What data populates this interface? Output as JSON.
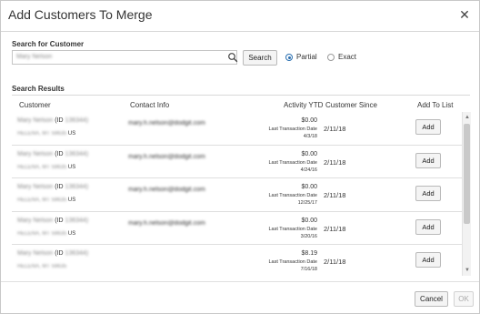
{
  "dialog": {
    "title": "Add Customers To Merge",
    "close_glyph": "✕"
  },
  "search": {
    "label": "Search for Customer",
    "value": "Mary Nelson",
    "button_label": "Search",
    "match_options": [
      {
        "label": "Partial",
        "selected": true
      },
      {
        "label": "Exact",
        "selected": false
      }
    ]
  },
  "results": {
    "label": "Search Results",
    "columns": {
      "customer": "Customer",
      "contact": "Contact Info",
      "activity": "Activity YTD",
      "since": "Customer Since",
      "add": "Add To List"
    },
    "rows": [
      {
        "name": "Mary Nelson",
        "id_prefix": "(ID",
        "id_value": "136344)",
        "address": "HELENA, MT 59635",
        "country": "US",
        "email": "mary.h.nelson@dodgit.com",
        "activity": "$0.00",
        "last_label": "Last Transaction Date",
        "last_date": "4/3/18",
        "since": "2/11/18",
        "add_label": "Add"
      },
      {
        "name": "Mary Nelson",
        "id_prefix": "(ID",
        "id_value": "136344)",
        "address": "HELENA, MT 59635",
        "country": "US",
        "email": "mary.h.nelson@dodgit.com",
        "activity": "$0.00",
        "last_label": "Last Transaction Date",
        "last_date": "4/24/16",
        "since": "2/11/18",
        "add_label": "Add"
      },
      {
        "name": "Mary Nelson",
        "id_prefix": "(ID",
        "id_value": "136344)",
        "address": "HELENA, MT 59635",
        "country": "US",
        "email": "mary.h.nelson@dodgit.com",
        "activity": "$0.00",
        "last_label": "Last Transaction Date",
        "last_date": "12/25/17",
        "since": "2/11/18",
        "add_label": "Add"
      },
      {
        "name": "Mary Nelson",
        "id_prefix": "(ID",
        "id_value": "136344)",
        "address": "HELENA, MT 59635",
        "country": "US",
        "email": "mary.h.nelson@dodgit.com",
        "activity": "$0.00",
        "last_label": "Last Transaction Date",
        "last_date": "3/20/16",
        "since": "2/11/18",
        "add_label": "Add"
      },
      {
        "name": "Mary Nelson",
        "id_prefix": "(ID",
        "id_value": "136344)",
        "address": "HELENA, MT 59635",
        "country": "",
        "email": "",
        "activity": "$8.19",
        "last_label": "Last Transaction Date",
        "last_date": "7/16/18",
        "since": "2/11/18",
        "add_label": "Add"
      }
    ]
  },
  "footer": {
    "cancel_label": "Cancel",
    "ok_label": "OK"
  },
  "colors": {
    "accent": "#2a6fb0",
    "border": "#c8c8c8"
  }
}
